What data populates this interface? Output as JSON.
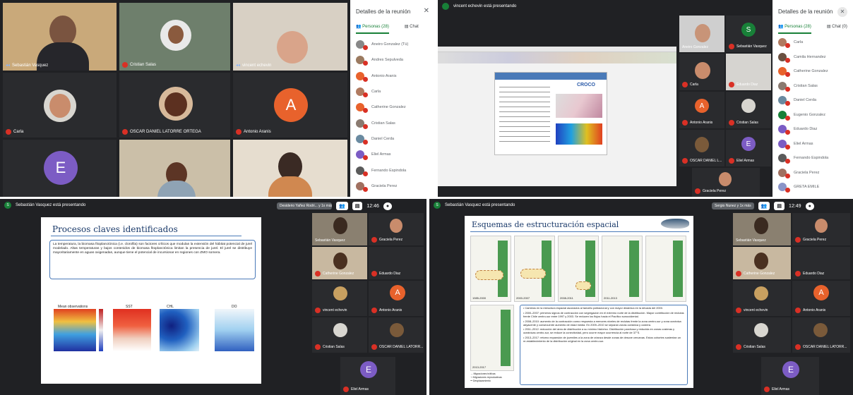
{
  "q1": {
    "tiles": [
      {
        "name": "Sebastián Vasquez"
      },
      {
        "name": "Cristian Salas"
      },
      {
        "name": "vincent echevin"
      },
      {
        "name": "Carla"
      },
      {
        "name": "OSCAR DANIEL LATORRE ORTEGA"
      },
      {
        "name": "Antonio Aranis"
      },
      {
        "initial": "E"
      },
      {
        "name": ""
      },
      {
        "name": ""
      }
    ],
    "avatarA": "A",
    "panel": {
      "title": "Detalles de la reunión",
      "tab_people": "Personas (28)",
      "tab_chat": "Chat",
      "people": [
        "Aneiro Gonzalez (Tú)",
        "Andres Sepulveda",
        "Antonio Aranis",
        "Carla",
        "Catherine Gonzalez",
        "Cristian Salas",
        "Daniel Cerda",
        "Eliel Armas",
        "Fernando Espindola",
        "Graciela Perez"
      ]
    }
  },
  "q2": {
    "presenting": "vincent echevin está presentando",
    "tiles": [
      {
        "name": "Aneiro Gonzalez"
      },
      {
        "name": "Sebastián Vasquez",
        "initial": "S"
      },
      {
        "name": "Carla"
      },
      {
        "name": "Eduardo Diaz"
      },
      {
        "name": "Antonio Aranis",
        "initial": "A"
      },
      {
        "name": "Cristian Salas"
      },
      {
        "name": "OSCAR DANIEL L..."
      },
      {
        "name": "Eliel Armas",
        "initial": "E"
      },
      {
        "name": "Graciela Perez"
      }
    ],
    "slide_brand": "CROCO",
    "panel": {
      "title": "Detalles de la reunión",
      "tab_people": "Personas (28)",
      "tab_chat": "Chat (0)",
      "people": [
        "Carla",
        "Camila Hernandez",
        "Catherine Gonzalez",
        "Cristian Salas",
        "Daniel Cerda",
        "Eugenio Gonzalez",
        "Eduardo Diaz",
        "Eliel Armas",
        "Fernando Espindola",
        "Graciela Perez",
        "GRETA EMILE"
      ]
    }
  },
  "q3": {
    "presenting": "Sebastián Vasquez está presentando",
    "host_chip": "Desiderio Yañez Rodri... y 1x más",
    "time": "12:46",
    "slide_title": "Procesos claves identificados",
    "slide_text": "La temperatura, la biomasa fitoplanctónica (i.e. clorofila) son factores críticos que modulan la extensión del hábitat potencial de jurel modelado. Altas temperaturas y bajos contenidos de biomasa fitoplanctónica limitan la presencia de jurel. El jurel se distribuye mayoritariamente en aguas oxigenadas, aunque tiene el potencial de incursionar en regiones con ZMO somera.",
    "map_titles": [
      "Mean observations",
      "SST",
      "CHL",
      "DO"
    ],
    "tiles": [
      {
        "name": "Sebastián Vasquez"
      },
      {
        "name": "Graciela Perez"
      },
      {
        "name": "Catherine Gonzalez"
      },
      {
        "name": "Eduardo Diaz"
      },
      {
        "name": "vincent echevin"
      },
      {
        "name": "Antonio Aranis",
        "initial": "A"
      },
      {
        "name": "Cristian Salas"
      },
      {
        "name": "OSCAR DANIEL LATORR..."
      },
      {
        "name": "Eliel Armas",
        "initial": "E"
      }
    ]
  },
  "q4": {
    "presenting": "Sebastián Vasquez está presentando",
    "host_chip": "Sergio Nunez y 1x más",
    "time": "12:49",
    "slide_title": "Esquemas de estructuración espacial",
    "periods": [
      "1985-2000",
      "2000-2007",
      "2008-2011",
      "2011-2013",
      "2013-2017"
    ],
    "bullets": [
      "Cambios en la estructura espacial asociados al tamaño poblacional y con mayor dinámica en la década del 2000.",
      "2000–2007: primeros signos de contracción con segregación en el extremo norte de la distribución. Mayor contribución de reclutas frente Chile centro-sur entre 1997 y 2003. Se reducen los flujos hacia el Pacífico suroccidental.",
      "2008–2010: aumento de la contracción como respuesta a menores niveles de reclutas frente la zona centro-sur y zona oceánica adyacente y consecuente aumento de edad media. En 2009–2010 se separan zonas oceánica y costera.",
      "2011–2012: reducción del área de distribución a su mínimo histórico. Distribución parchosa y reducida en zonas costeras y oceánicas centro-sur, se reduce la conectividad, pero ocurre mayor ocurrencia al norte de 37°S.",
      "2013–2017: retorno expansión de juveniles a la zona de crianza desde zonas de desove cercanas. Estos cohortes sustentan un re-establecimiento de la distribución original en la zona centro-sur."
    ],
    "legend": [
      "Migraciones tróficas",
      "Migraciones reproductivas",
      "Desplazamiento"
    ],
    "tiles": [
      {
        "name": "Sebastián Vasquez"
      },
      {
        "name": "Graciela Perez"
      },
      {
        "name": "Catherine Gonzalez"
      },
      {
        "name": "Eduardo Diaz"
      },
      {
        "name": "vincent echevin"
      },
      {
        "name": "Antonio Aranis",
        "initial": "A"
      },
      {
        "name": "Cristian Salas"
      },
      {
        "name": "OSCAR DANIEL LATORR..."
      },
      {
        "name": "Eliel Armas",
        "initial": "E"
      }
    ]
  }
}
